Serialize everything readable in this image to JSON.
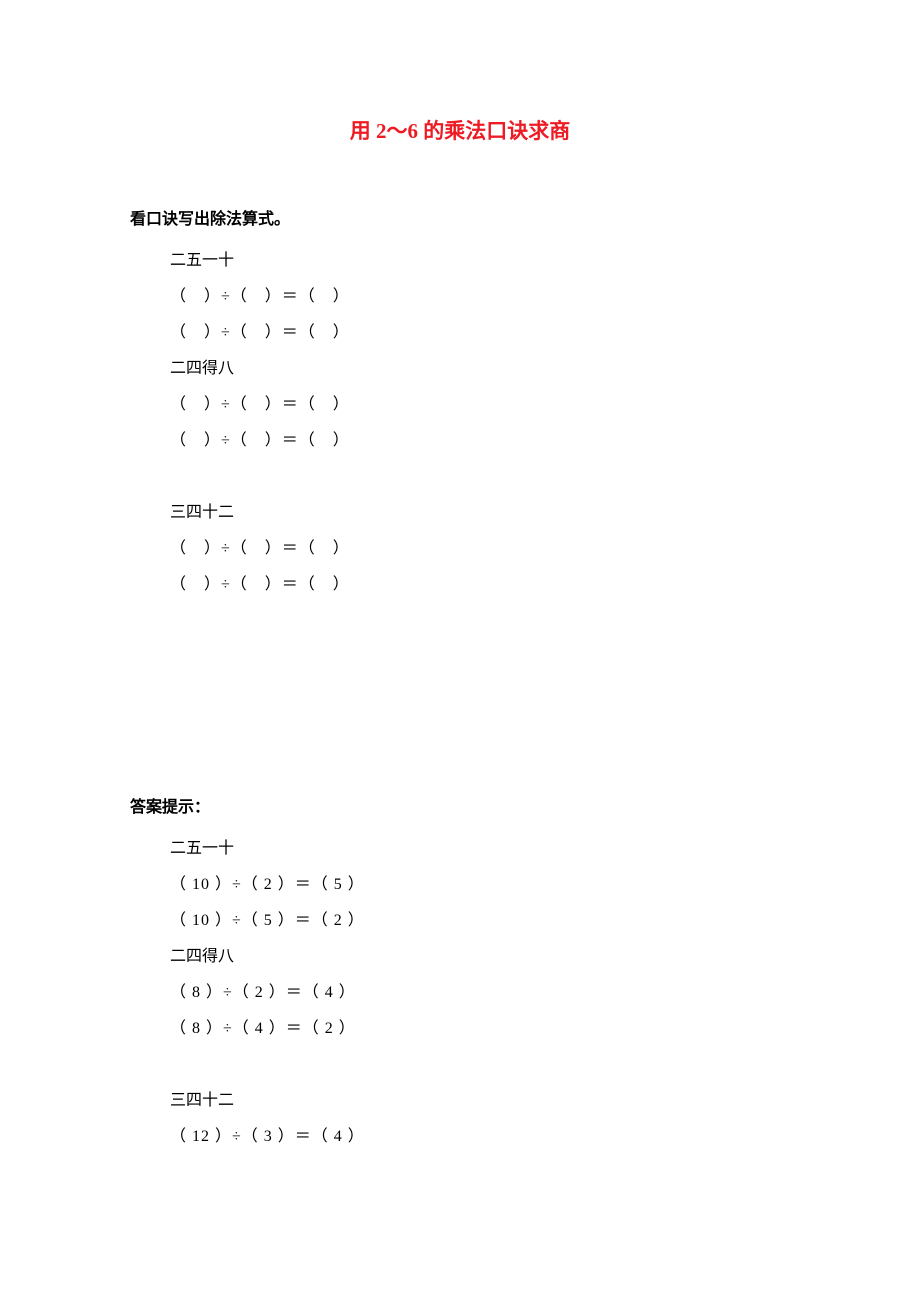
{
  "title": "用 2～6 的乘法口诀求商",
  "question_heading": "看口诀写出除法算式。",
  "answer_heading": "答案提示：",
  "questions": {
    "g1": {
      "label": "二五一十",
      "eq1": "（　）÷（　）＝（　）",
      "eq2": "（　）÷（　）＝（　）"
    },
    "g2": {
      "label": "二四得八",
      "eq1": "（　）÷（　）＝（　）",
      "eq2": "（　）÷（　）＝（　）"
    },
    "g3": {
      "label": "三四十二",
      "eq1": "（　）÷（　）＝（　）",
      "eq2": "（　）÷（　）＝（　）"
    }
  },
  "answers": {
    "g1": {
      "label": "二五一十",
      "eq1": "（ 10 ）÷（ 2 ）＝（ 5 ）",
      "eq2": "（ 10 ）÷（ 5 ）＝（ 2 ）"
    },
    "g2": {
      "label": "二四得八",
      "eq1": "（ 8  ）÷（ 2 ）＝（ 4 ）",
      "eq2": "（ 8  ）÷（ 4 ）＝（ 2 ）"
    },
    "g3": {
      "label": "三四十二",
      "eq1": "（ 12 ）÷（ 3 ）＝（ 4 ）"
    }
  }
}
